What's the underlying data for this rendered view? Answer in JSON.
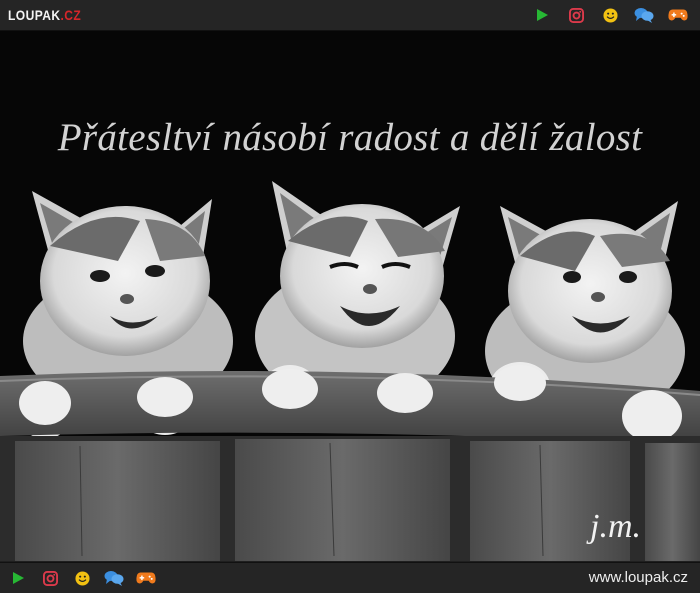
{
  "brand": {
    "logo_main": "LOUPAK",
    "logo_suffix": ".CZ"
  },
  "header": {
    "icons": [
      "play-icon",
      "instagram-icon",
      "smiley-icon",
      "chat-icon",
      "gamepad-icon"
    ]
  },
  "content": {
    "caption": "Přátesltví násobí radost a dělí žalost",
    "signature": "j.m."
  },
  "footer": {
    "icons": [
      "play-icon",
      "instagram-icon",
      "smiley-icon",
      "chat-icon",
      "gamepad-icon"
    ],
    "site_url": "www.loupak.cz"
  },
  "colors": {
    "bar_background": "#252525",
    "play": "#27b834",
    "instagram": "#dc3a4b",
    "smiley": "#f2c112",
    "chat": "#3b8fe0",
    "gamepad": "#f07a1c"
  }
}
